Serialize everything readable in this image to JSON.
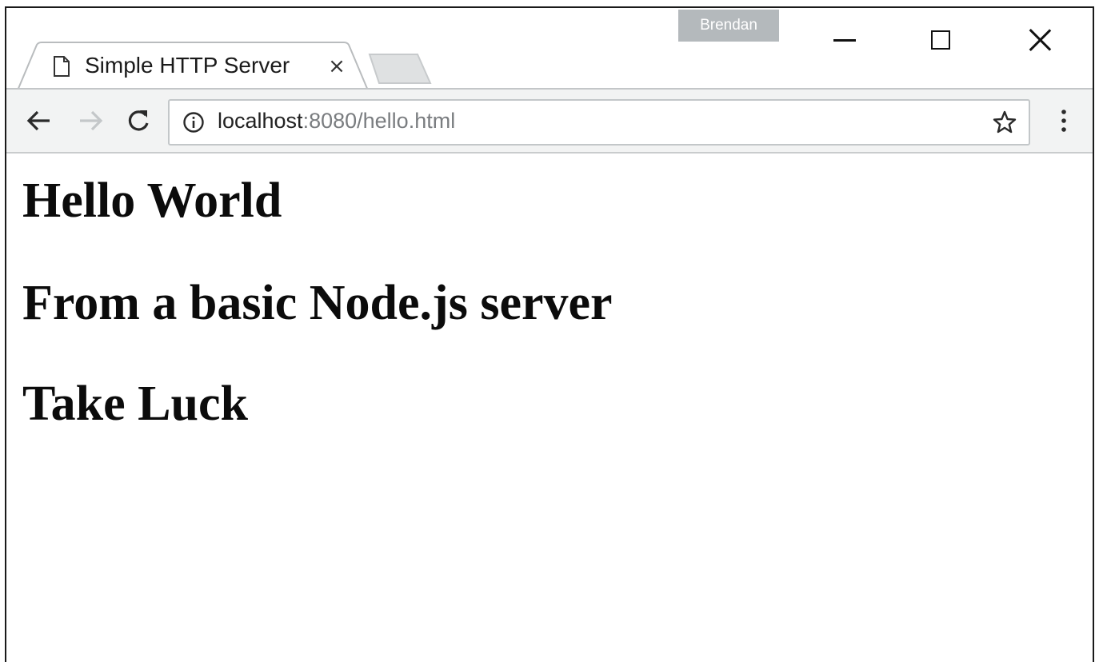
{
  "window": {
    "profile_name": "Brendan",
    "controls": {
      "minimize_icon": "minimize-icon",
      "maximize_icon": "maximize-icon",
      "close_icon": "close-icon"
    }
  },
  "tabs": [
    {
      "title": "Simple HTTP Server",
      "close_label": "×",
      "favicon": "page-icon",
      "active": true
    }
  ],
  "toolbar": {
    "back_icon": "arrow-left-icon",
    "forward_icon": "arrow-right-icon",
    "reload_icon": "reload-icon",
    "site_info_icon": "info-icon",
    "url_host": "localhost",
    "url_rest": ":8080/hello.html",
    "bookmark_icon": "star-icon",
    "menu_icon": "kebab-menu-icon"
  },
  "page": {
    "headings": [
      "Hello World",
      "From a basic Node.js server",
      "Take Luck"
    ]
  },
  "colors": {
    "toolbar_bg": "#f2f3f3",
    "profile_badge_bg": "#b4b9bc",
    "url_dim": "#7a7d80"
  }
}
